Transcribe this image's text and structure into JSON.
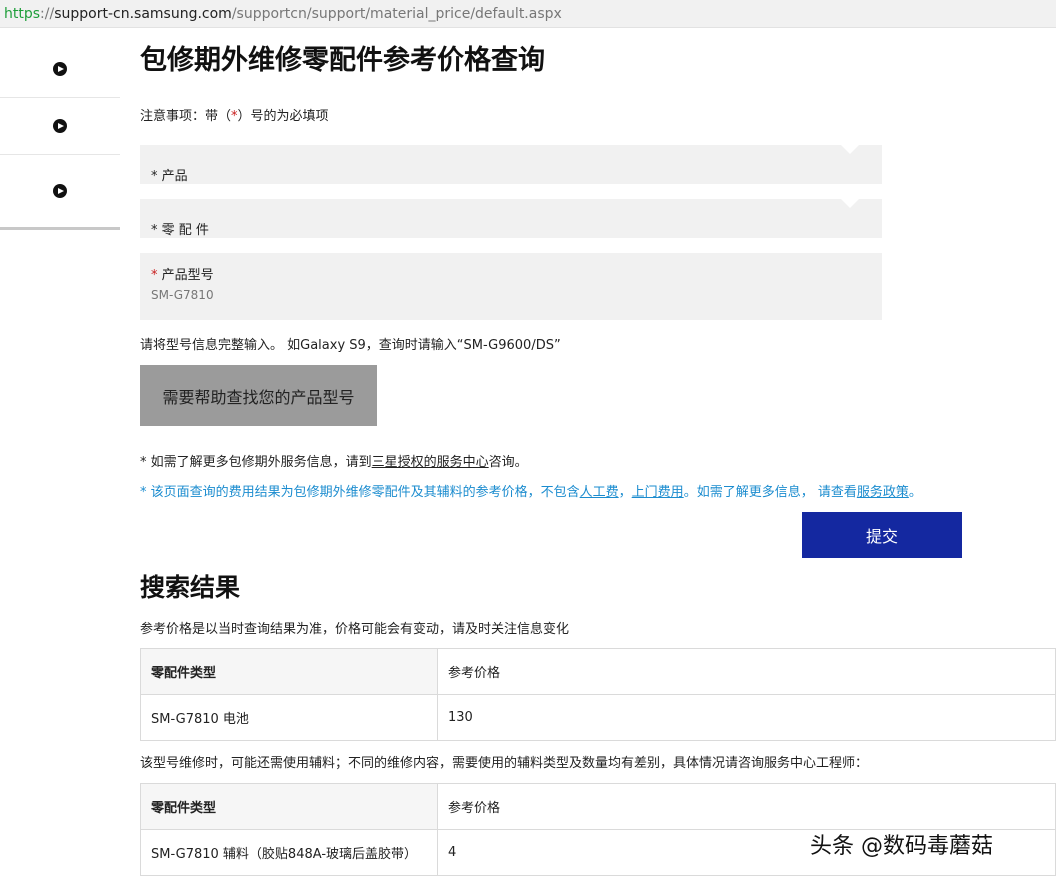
{
  "browser": {
    "url_scheme": "https",
    "url_sep": "://",
    "url_host": "support-cn.samsung.com",
    "url_path": "/supportcn/support/material_price/default.aspx"
  },
  "sidebar": {
    "items": [
      {
        "icon": "play-circle-icon"
      },
      {
        "icon": "play-circle-icon"
      },
      {
        "icon": "play-circle-icon"
      }
    ]
  },
  "page": {
    "title": "包修期外维修零配件参考价格查询",
    "notice_prefix": "注意事项：带（",
    "notice_star": "*",
    "notice_suffix": "）号的为必填项"
  },
  "form": {
    "product_label": "* 产品",
    "part_label": "* 零 配 件",
    "model_star": "*",
    "model_label": " 产品型号",
    "model_value": "SM-G7810",
    "hint": "请将型号信息完整输入。 如Galaxy S9，查询时请输入“SM-G9600/DS”",
    "help_button": "需要帮助查找您的产品型号",
    "submit_button": "提交"
  },
  "info": {
    "line1_prefix": "* 如需了解更多包修期外服务信息，请到",
    "line1_link": "三星授权的服务中心",
    "line1_suffix": "咨询。",
    "line2_prefix": "* 该页面查询的费用结果为包修期外维修零配件及其辅料的参考价格，不包含",
    "line2_link1": "人工费",
    "line2_sep1": "，",
    "line2_link2": "上门费用",
    "line2_mid": "。如需了解更多信息， 请查看",
    "line2_link3": "服务政策",
    "line2_end": "。"
  },
  "results": {
    "title": "搜索结果",
    "note": "参考价格是以当时查询结果为准，价格可能会有变动，请及时关注信息变化",
    "table1": {
      "headers": [
        "零配件类型",
        "参考价格"
      ],
      "rows": [
        [
          "SM-G7810 电池",
          "130"
        ]
      ]
    },
    "assist_note": "该型号维修时，可能还需使用辅料；不同的维修内容，需要使用的辅料类型及数量均有差别，具体情况请咨询服务中心工程师：",
    "table2": {
      "headers": [
        "零配件类型",
        "参考价格"
      ],
      "rows": [
        [
          "SM-G7810 辅料（胶贴848A-玻璃后盖胶带）",
          "4"
        ]
      ]
    }
  },
  "watermark": "头条 @数码毒蘑菇",
  "colors": {
    "submit_bg": "#1428a0",
    "help_bg": "#9b9b9b",
    "link_blue": "#1b8ccf",
    "required_red": "#c81c1c"
  }
}
